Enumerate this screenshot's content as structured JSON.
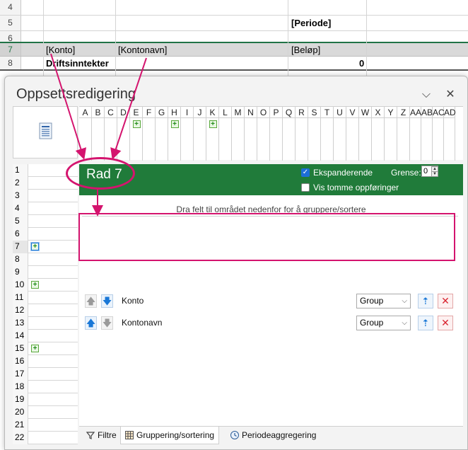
{
  "sheet": {
    "rows": [
      {
        "num": "4",
        "cells": []
      },
      {
        "num": "5",
        "cells": [
          {
            "text": "[Periode]",
            "bold": true
          }
        ]
      },
      {
        "num": "6",
        "cells": []
      },
      {
        "num": "7",
        "cells": [
          {
            "text": "[Konto]"
          },
          {
            "text": "[Kontonavn]"
          },
          {
            "text": "[Beløp]"
          }
        ]
      },
      {
        "num": "8",
        "cells": [
          {
            "text": "Driftsinntekter",
            "bold": true
          },
          {
            "text": "0",
            "bold": true
          }
        ]
      }
    ]
  },
  "dialog": {
    "title": "Oppsettsredigering",
    "collapse_glyph": "⌵",
    "close_glyph": "✕",
    "columns": [
      "A",
      "B",
      "C",
      "D",
      "E",
      "F",
      "G",
      "H",
      "I",
      "J",
      "K",
      "L",
      "M",
      "N",
      "O",
      "P",
      "Q",
      "R",
      "S",
      "T",
      "U",
      "V",
      "W",
      "X",
      "Y",
      "Z",
      "AA",
      "AB",
      "AC",
      "AD"
    ],
    "columns_with_plus": [
      "E",
      "H",
      "K"
    ],
    "rows": [
      "1",
      "2",
      "3",
      "4",
      "5",
      "6",
      "7",
      "8",
      "9",
      "10",
      "11",
      "12",
      "13",
      "14",
      "15",
      "16",
      "17",
      "18",
      "19",
      "20",
      "21",
      "22"
    ],
    "rows_with_plus": [
      "7",
      "10",
      "15"
    ],
    "selected_row": "7",
    "row_header": {
      "title": "Rad 7",
      "expanding_label": "Ekspanderende",
      "expanding_checked": true,
      "show_empty_label": "Vis tomme oppføringer",
      "show_empty_checked": false,
      "limit_label": "Grense:",
      "limit_value": "0"
    },
    "drop_hint": "Dra felt til området nedenfor for å gruppere/sortere",
    "group_fields": [
      {
        "name": "Konto",
        "mode": "Group",
        "up_enabled": false,
        "down_enabled": true
      },
      {
        "name": "Kontonavn",
        "mode": "Group",
        "up_enabled": true,
        "down_enabled": false
      }
    ],
    "tabs": [
      {
        "label": "Filtre",
        "icon": "filter-icon",
        "active": false
      },
      {
        "label": "Gruppering/sortering",
        "icon": "grid-icon",
        "active": true
      },
      {
        "label": "Periodeaggregering",
        "icon": "clock-icon",
        "active": false
      }
    ]
  },
  "colors": {
    "annotation": "#d4146e",
    "header_green": "#207b3a",
    "accent_blue": "#1a78d7",
    "delete_red": "#d9232f"
  }
}
